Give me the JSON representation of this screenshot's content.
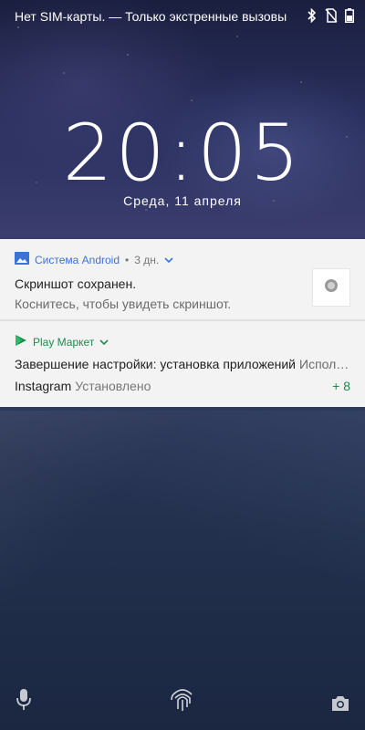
{
  "status_bar": {
    "text": "Нет SIM-карты. — Только экстренные вызовы",
    "icons": [
      "bluetooth-icon",
      "no-sim-icon",
      "battery-icon"
    ]
  },
  "lockscreen": {
    "time": "20:05",
    "date": "Среда, 11 апреля"
  },
  "notifications": [
    {
      "app": "Система Android",
      "age": "3 дн.",
      "title": "Скриншот сохранен.",
      "text": "Коснитесь, чтобы увидеть скриншот.",
      "accent": "#3b74d6",
      "icon": "image-icon"
    },
    {
      "app": "Play Маркет",
      "title": "Завершение настройки: установка приложений",
      "title_extra": "Исполь...",
      "app_item": "Instagram",
      "app_status": "Установлено",
      "count": "+ 8",
      "accent": "#1e8a4c",
      "icon": "play-store-icon"
    }
  ],
  "bottom": {
    "icons": [
      "microphone-icon",
      "fingerprint-icon",
      "camera-icon"
    ]
  }
}
